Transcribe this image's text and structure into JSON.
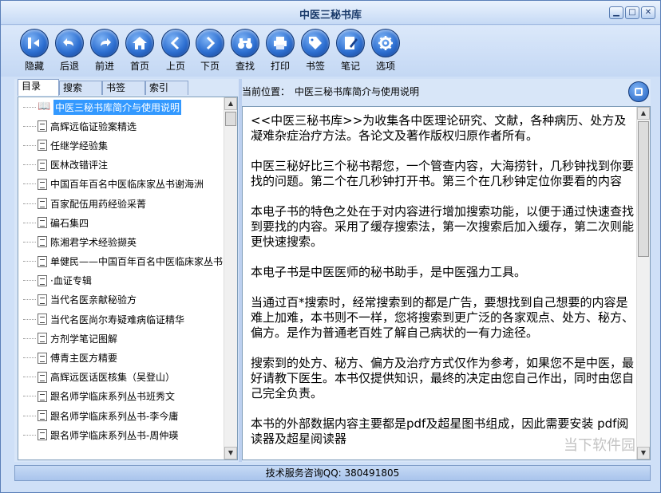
{
  "window": {
    "title": "中医三秘书库"
  },
  "toolbar": {
    "buttons": [
      {
        "label": "隐藏",
        "icon": "hide-panel-icon"
      },
      {
        "label": "后退",
        "icon": "back-arrow-icon"
      },
      {
        "label": "前进",
        "icon": "forward-arrow-icon"
      },
      {
        "label": "首页",
        "icon": "home-icon"
      },
      {
        "label": "上页",
        "icon": "chevron-left-icon"
      },
      {
        "label": "下页",
        "icon": "chevron-right-icon"
      },
      {
        "label": "查找",
        "icon": "binoculars-icon"
      },
      {
        "label": "打印",
        "icon": "printer-icon"
      },
      {
        "label": "书签",
        "icon": "bookmark-tag-icon"
      },
      {
        "label": "笔记",
        "icon": "note-edit-icon"
      },
      {
        "label": "选项",
        "icon": "gear-icon"
      }
    ]
  },
  "sidebar": {
    "tabs": [
      {
        "label": "目录",
        "active": true
      },
      {
        "label": "搜索"
      },
      {
        "label": "书签"
      },
      {
        "label": "索引"
      }
    ],
    "items": [
      {
        "label": "中医三秘书库简介与使用说明",
        "selected": true,
        "icon": "open-book-icon"
      },
      {
        "label": "高辉远临证验案精选"
      },
      {
        "label": "任继学经验集"
      },
      {
        "label": "医林改错评注"
      },
      {
        "label": "中国百年百名中医临床家丛书谢海洲"
      },
      {
        "label": "百家配伍用药经验采菁"
      },
      {
        "label": "碥石集四"
      },
      {
        "label": "陈湘君学术经验撷英"
      },
      {
        "label": "单健民——中国百年百名中医临床家丛书"
      },
      {
        "label": "·血证专辑"
      },
      {
        "label": "当代名医亲献秘验方"
      },
      {
        "label": "当代名医尚尔寿疑难病临证精华"
      },
      {
        "label": "方剂学笔记图解"
      },
      {
        "label": "傅青主医方精要"
      },
      {
        "label": "高辉远医话医核集（吴登山）"
      },
      {
        "label": "跟名师学临床系列丛书班秀文"
      },
      {
        "label": "跟名师学临床系列丛书-李今庸"
      },
      {
        "label": "跟名师学临床系列丛书-周仲瑛"
      }
    ]
  },
  "main": {
    "location_prefix": "当前位置：",
    "location": "中医三秘书库简介与使用说明",
    "paragraphs": [
      "<<中医三秘书库>>为收集各中医理论研究、文献，各种病历、处方及凝难杂症治疗方法。各论文及著作版权归原作者所有。",
      "中医三秘好比三个秘书帮您，一个管查内容，大海捞针，几秒钟找到你要找的问题。第二个在几秒钟打开书。第三个在几秒钟定位你要看的内容",
      "本电子书的特色之处在于对内容进行增加搜索功能，以便于通过快速查找到要找的内容。采用了缓存搜索法，第一次搜索后加入缓存，第二次则能更快速搜索。",
      "本电子书是中医医师的秘书助手，是中医强力工具。",
      "当通过百*搜索时，经常搜索到的都是广告，要想找到自己想要的内容是难上加难，本书则不一样，您将搜索到更广泛的各家观点、处方、秘方、偏方。是作为普通老百姓了解自己病状的一有力途径。",
      "搜索到的处方、秘方、偏方及治疗方式仅作为参考，如果您不是中医，最好请教下医生。本书仅提供知识，最终的决定由您自己作出，同时由您自己完全负责。",
      "本书的外部数据内容主要都是pdf及超星图书组成，因此需要安装 pdf阅读器及超星阅读器"
    ]
  },
  "status": {
    "text": "技术服务咨询QQ: 380491805"
  },
  "watermark": "当下软件园"
}
